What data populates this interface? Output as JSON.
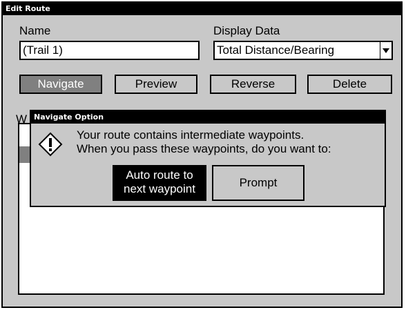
{
  "window": {
    "title": "Edit Route"
  },
  "form": {
    "name_label": "Name",
    "name_value": "(Trail 1)",
    "display_label": "Display Data",
    "display_value": "Total Distance/Bearing"
  },
  "buttons": {
    "navigate": "Navigate",
    "preview": "Preview",
    "reverse": "Reverse",
    "delete": "Delete"
  },
  "list": {
    "label_visible": "W"
  },
  "dialog": {
    "title": "Navigate Option",
    "icon": "warning-diamond",
    "message_line1": "Your route contains intermediate waypoints.",
    "message_line2": "When you pass these waypoints, do you want to:",
    "auto_line1": "Auto route to",
    "auto_line2": "next waypoint",
    "prompt": "Prompt"
  }
}
